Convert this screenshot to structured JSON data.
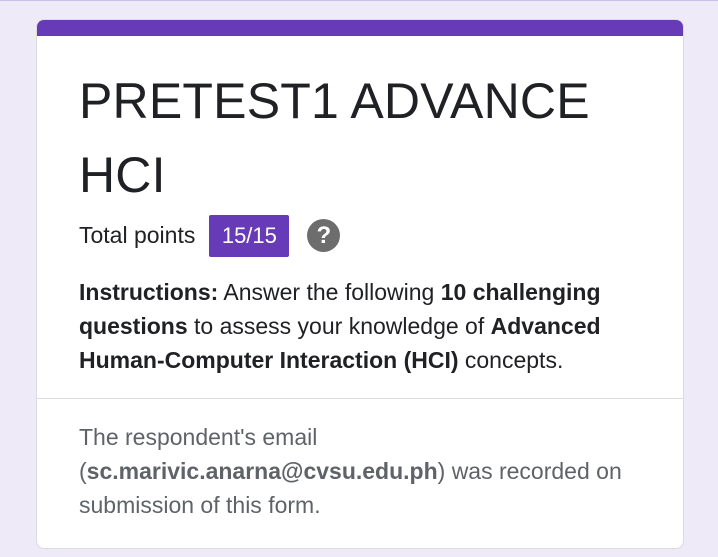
{
  "form": {
    "title": "PRETEST1 ADVANCE HCI",
    "points": {
      "label": "Total points",
      "score": "15/15"
    },
    "help_icon": "question-mark-icon",
    "instructions": {
      "lead": "Instructions:",
      "t1": " Answer the following ",
      "b1": "10 challenging questions",
      "t2": " to assess your knowledge of ",
      "b2": "Advanced Human-Computer Interaction (HCI)",
      "t3": " concepts."
    },
    "email_note": {
      "pre": "The respondent's email (",
      "email": "sc.marivic.anarna@cvsu.edu.ph",
      "post": ") was recorded on submission of this form."
    }
  },
  "colors": {
    "accent": "#673ab7",
    "background": "#efeaf8",
    "help_icon": "#6d6d6d"
  }
}
